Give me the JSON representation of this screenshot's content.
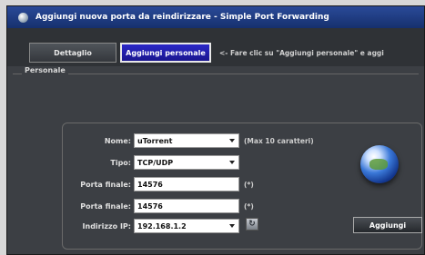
{
  "window": {
    "title": "Aggiungi nuova porta da reindirizzare - Simple Port Forwarding"
  },
  "toolbar": {
    "tab_details": "Dettaglio",
    "tab_custom": "Aggiungi personale",
    "hint": "<- Fare clic su \"Aggiungi personale\" e aggi"
  },
  "section": {
    "label": "Personale"
  },
  "form": {
    "name_label": "Nome:",
    "name_value": "uTorrent",
    "name_note": "(Max 10 caratteri)",
    "type_label": "Tipo:",
    "type_value": "TCP/UDP",
    "start_port_label": "Porta finale:",
    "start_port_value": "14576",
    "start_port_note": "(*)",
    "end_port_label": "Porta finale:",
    "end_port_value": "14576",
    "end_port_note": "(*)",
    "ip_label": "Indirizzo IP:",
    "ip_value": "192.168.1.2",
    "add_button": "Aggiungi"
  },
  "icons": {
    "app": "app-icon",
    "globe": "globe-icon",
    "refresh": "refresh-icon"
  }
}
